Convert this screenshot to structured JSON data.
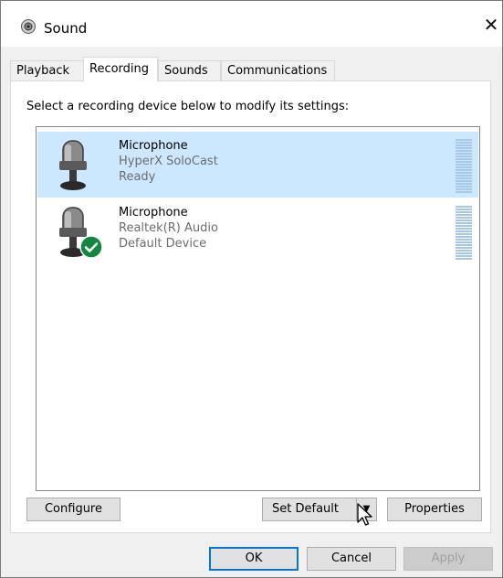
{
  "window": {
    "title": "Sound",
    "close_glyph": "✕"
  },
  "tabs": [
    {
      "label": "Playback",
      "active": false
    },
    {
      "label": "Recording",
      "active": true
    },
    {
      "label": "Sounds",
      "active": false
    },
    {
      "label": "Communications",
      "active": false
    }
  ],
  "instruction": "Select a recording device below to modify its settings:",
  "devices": [
    {
      "name": "Microphone",
      "sub": "HyperX SoloCast",
      "status": "Ready",
      "selected": true,
      "icon": "microphone-icon",
      "badge": ""
    },
    {
      "name": "Microphone",
      "sub": "Realtek(R) Audio",
      "status": "Default Device",
      "selected": false,
      "icon": "microphone-icon",
      "badge": "green-check-icon"
    }
  ],
  "buttons": {
    "configure": "Configure",
    "set_default": "Set Default",
    "set_default_arrow": "▼",
    "properties": "Properties",
    "ok": "OK",
    "cancel": "Cancel",
    "apply": "Apply"
  },
  "colors": {
    "selection": "#cce8ff",
    "meter": "#a6c8ec",
    "check_badge": "#10893e",
    "focus_border": "#0078d7"
  }
}
